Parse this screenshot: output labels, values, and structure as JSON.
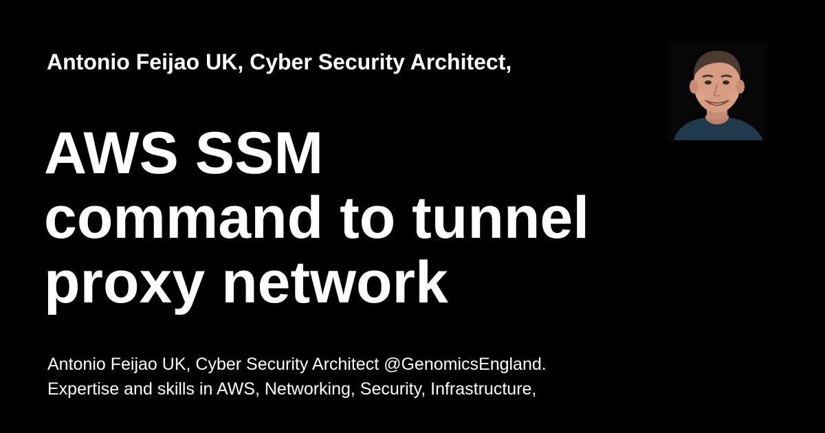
{
  "card": {
    "author_line": "Antonio Feijao UK, Cyber Security Architect,",
    "title_lines": [
      "AWS SSM",
      "command to tunnel",
      "proxy network"
    ],
    "description_lines": [
      "Antonio Feijao UK, Cyber Security Architect @GenomicsEngland.",
      "Expertise and skills in AWS, Networking, Security, Infrastructure,"
    ],
    "avatar_icon": "person-photo"
  },
  "colors": {
    "background": "#000000",
    "text": "#ffffff"
  }
}
